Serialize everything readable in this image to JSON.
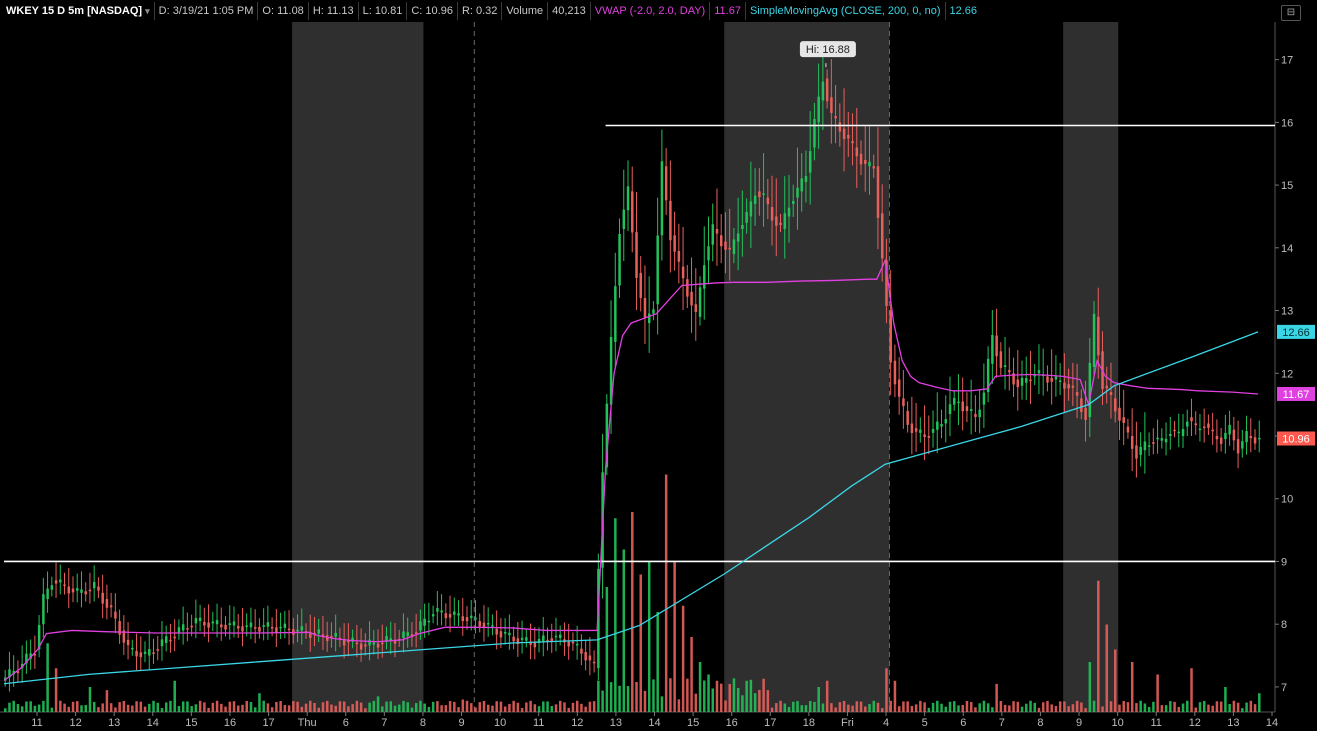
{
  "header": {
    "symbol": "WKEY 15 D 5m [NASDAQ]",
    "date": "D: 3/19/21 1:05 PM",
    "open": "O: 11.08",
    "high": "H: 11.13",
    "low": "L: 10.81",
    "close": "C: 10.96",
    "range": "R: 0.32",
    "volume_label": "Volume",
    "volume_value": "40,213",
    "vwap_label": "VWAP (-2.0, 2.0, DAY)",
    "vwap_value": "11.67",
    "sma_label": "SimpleMovingAvg (CLOSE, 200, 0, no)",
    "sma_value": "12.66"
  },
  "colors": {
    "up": "#22c25a",
    "down": "#e8605c",
    "vwap": "#e040e0",
    "sma": "#3ad6e6",
    "hline": "#ffffff",
    "extended_hours_shade": "#2f2f2f"
  },
  "chart_data": {
    "type": "candlestick",
    "title": "WKEY 15 D 5m [NASDAQ]",
    "ylim": [
      6.6,
      17.6
    ],
    "y_ticks": [
      7,
      8,
      9,
      10,
      11,
      12,
      13,
      14,
      15,
      16,
      17
    ],
    "x_tick_labels": [
      "11",
      "12",
      "13",
      "14",
      "15",
      "16",
      "17",
      "Thu",
      "6",
      "7",
      "8",
      "9",
      "10",
      "11",
      "12",
      "13",
      "14",
      "15",
      "16",
      "17",
      "18",
      "Fri",
      "4",
      "5",
      "6",
      "7",
      "8",
      "9",
      "10",
      "11",
      "12",
      "13",
      "14"
    ],
    "horizontal_lines": [
      9.0,
      15.95
    ],
    "high_annotation": "Hi: 16.88",
    "price_badges": [
      {
        "name": "sma",
        "value": "12.66"
      },
      {
        "name": "vwap",
        "value": "11.67"
      },
      {
        "name": "last",
        "value": "10.96"
      }
    ],
    "price_path": [
      [
        0,
        7.1
      ],
      [
        2,
        7.3
      ],
      [
        4,
        7.6
      ],
      [
        5,
        8.4
      ],
      [
        6,
        8.7
      ],
      [
        9,
        8.5
      ],
      [
        11,
        8.6
      ],
      [
        13,
        8.2
      ],
      [
        15,
        7.6
      ],
      [
        17,
        7.5
      ],
      [
        19,
        7.7
      ],
      [
        21,
        7.9
      ],
      [
        23,
        8.05
      ],
      [
        25,
        8.0
      ],
      [
        27,
        7.98
      ],
      [
        29,
        7.95
      ],
      [
        31,
        7.96
      ],
      [
        33,
        7.94
      ],
      [
        35,
        7.9
      ],
      [
        37,
        7.85
      ],
      [
        39,
        7.8
      ],
      [
        41,
        7.72
      ],
      [
        43,
        7.66
      ],
      [
        45,
        7.72
      ],
      [
        47,
        7.78
      ],
      [
        49,
        7.9
      ],
      [
        51,
        8.2
      ],
      [
        53,
        8.15
      ],
      [
        55,
        8.1
      ],
      [
        57,
        8.0
      ],
      [
        59,
        7.85
      ],
      [
        61,
        7.75
      ],
      [
        63,
        7.7
      ],
      [
        65,
        7.8
      ],
      [
        67,
        7.72
      ],
      [
        69,
        7.5
      ],
      [
        70,
        7.3
      ],
      [
        71,
        10.5
      ],
      [
        72,
        12.5
      ],
      [
        73,
        14.3
      ],
      [
        74,
        14.9
      ],
      [
        75,
        13.6
      ],
      [
        76,
        12.8
      ],
      [
        77,
        13.1
      ],
      [
        78,
        15.3
      ],
      [
        79,
        14.2
      ],
      [
        80,
        13.7
      ],
      [
        81,
        13.3
      ],
      [
        82,
        12.9
      ],
      [
        83,
        13.8
      ],
      [
        84,
        14.3
      ],
      [
        85,
        14.1
      ],
      [
        86,
        13.9
      ],
      [
        87,
        14.3
      ],
      [
        88,
        14.5
      ],
      [
        89,
        14.9
      ],
      [
        90,
        14.8
      ],
      [
        91,
        14.5
      ],
      [
        92,
        14.3
      ],
      [
        93,
        14.7
      ],
      [
        94,
        14.9
      ],
      [
        95,
        15.2
      ],
      [
        96,
        16.0
      ],
      [
        97,
        16.7
      ],
      [
        98,
        16.1
      ],
      [
        99,
        15.9
      ],
      [
        100,
        15.7
      ],
      [
        101,
        15.5
      ],
      [
        102,
        15.3
      ],
      [
        103,
        15.3
      ],
      [
        104,
        13.8
      ],
      [
        105,
        12.2
      ],
      [
        106,
        11.6
      ],
      [
        107,
        11.2
      ],
      [
        108,
        11.05
      ],
      [
        109,
        11.0
      ],
      [
        110,
        11.1
      ],
      [
        111,
        11.2
      ],
      [
        112,
        11.5
      ],
      [
        113,
        11.55
      ],
      [
        114,
        11.4
      ],
      [
        115,
        11.3
      ],
      [
        116,
        11.7
      ],
      [
        117,
        12.6
      ],
      [
        118,
        12.1
      ],
      [
        119,
        12.0
      ],
      [
        120,
        11.8
      ],
      [
        121,
        11.9
      ],
      [
        122,
        12.0
      ],
      [
        123,
        11.95
      ],
      [
        124,
        11.9
      ],
      [
        125,
        11.85
      ],
      [
        126,
        11.8
      ],
      [
        127,
        11.6
      ],
      [
        128,
        11.3
      ],
      [
        129,
        12.9
      ],
      [
        130,
        11.8
      ],
      [
        131,
        11.6
      ],
      [
        132,
        11.3
      ],
      [
        133,
        11.0
      ],
      [
        134,
        10.7
      ],
      [
        135,
        10.85
      ],
      [
        136,
        10.95
      ],
      [
        137,
        10.9
      ],
      [
        138,
        11.1
      ],
      [
        139,
        11.0
      ],
      [
        140,
        11.3
      ],
      [
        141,
        11.1
      ],
      [
        142,
        11.2
      ],
      [
        143,
        11.0
      ],
      [
        144,
        10.95
      ],
      [
        145,
        11.1
      ],
      [
        146,
        10.8
      ],
      [
        147,
        11.0
      ],
      [
        148,
        10.96
      ]
    ],
    "vwap_path": [
      [
        0,
        7.1
      ],
      [
        2,
        7.3
      ],
      [
        4,
        7.6
      ],
      [
        5,
        7.85
      ],
      [
        8,
        7.9
      ],
      [
        12,
        7.88
      ],
      [
        18,
        7.86
      ],
      [
        24,
        7.86
      ],
      [
        30,
        7.86
      ],
      [
        36,
        7.87
      ],
      [
        37,
        7.82
      ],
      [
        39,
        7.77
      ],
      [
        41,
        7.74
      ],
      [
        44,
        7.72
      ],
      [
        47,
        7.75
      ],
      [
        49,
        7.85
      ],
      [
        52,
        7.95
      ],
      [
        56,
        7.95
      ],
      [
        60,
        7.94
      ],
      [
        64,
        7.9
      ],
      [
        68,
        7.9
      ],
      [
        70,
        7.9
      ],
      [
        71,
        10.5
      ],
      [
        72,
        12.0
      ],
      [
        73,
        12.6
      ],
      [
        74,
        12.8
      ],
      [
        75,
        12.85
      ],
      [
        77,
        12.95
      ],
      [
        79,
        13.25
      ],
      [
        80,
        13.4
      ],
      [
        82,
        13.42
      ],
      [
        84,
        13.44
      ],
      [
        86,
        13.45
      ],
      [
        90,
        13.45
      ],
      [
        94,
        13.47
      ],
      [
        98,
        13.48
      ],
      [
        102,
        13.5
      ],
      [
        103,
        13.5
      ],
      [
        104,
        13.8
      ],
      [
        105,
        12.8
      ],
      [
        106,
        12.2
      ],
      [
        107,
        11.95
      ],
      [
        108,
        11.85
      ],
      [
        110,
        11.78
      ],
      [
        112,
        11.72
      ],
      [
        114,
        11.72
      ],
      [
        116,
        11.75
      ],
      [
        117,
        11.95
      ],
      [
        119,
        11.97
      ],
      [
        121,
        11.98
      ],
      [
        123,
        11.97
      ],
      [
        125,
        11.95
      ],
      [
        127,
        11.9
      ],
      [
        128,
        11.5
      ],
      [
        129,
        12.2
      ],
      [
        130,
        11.95
      ],
      [
        131,
        11.85
      ],
      [
        133,
        11.8
      ],
      [
        135,
        11.76
      ],
      [
        137,
        11.75
      ],
      [
        139,
        11.74
      ],
      [
        141,
        11.72
      ],
      [
        143,
        11.71
      ],
      [
        145,
        11.7
      ],
      [
        148,
        11.67
      ]
    ],
    "sma_path": [
      [
        0,
        7.05
      ],
      [
        10,
        7.2
      ],
      [
        20,
        7.3
      ],
      [
        30,
        7.4
      ],
      [
        40,
        7.5
      ],
      [
        50,
        7.6
      ],
      [
        60,
        7.7
      ],
      [
        70,
        7.75
      ],
      [
        75,
        7.98
      ],
      [
        85,
        8.8
      ],
      [
        95,
        9.7
      ],
      [
        100,
        10.2
      ],
      [
        104,
        10.55
      ],
      [
        112,
        10.85
      ],
      [
        120,
        11.15
      ],
      [
        128,
        11.5
      ],
      [
        131,
        11.8
      ],
      [
        140,
        12.25
      ],
      [
        148,
        12.66
      ]
    ],
    "volume_spikes": [
      [
        5,
        1.1
      ],
      [
        6,
        0.7
      ],
      [
        10,
        0.4
      ],
      [
        12,
        0.35
      ],
      [
        20,
        0.5
      ],
      [
        30,
        0.3
      ],
      [
        44,
        0.25
      ],
      [
        54,
        0.2
      ],
      [
        70,
        0.5
      ],
      [
        71,
        2.0
      ],
      [
        72,
        3.1
      ],
      [
        73,
        2.6
      ],
      [
        74,
        3.2
      ],
      [
        75,
        2.2
      ],
      [
        76,
        2.4
      ],
      [
        77,
        1.6
      ],
      [
        78,
        3.8
      ],
      [
        79,
        2.4
      ],
      [
        80,
        1.7
      ],
      [
        81,
        1.2
      ],
      [
        82,
        0.8
      ],
      [
        83,
        0.6
      ],
      [
        84,
        0.5
      ],
      [
        90,
        0.35
      ],
      [
        96,
        0.4
      ],
      [
        97,
        0.5
      ],
      [
        104,
        0.7
      ],
      [
        105,
        0.5
      ],
      [
        117,
        0.45
      ],
      [
        128,
        0.8
      ],
      [
        129,
        2.1
      ],
      [
        130,
        1.4
      ],
      [
        131,
        1.0
      ],
      [
        133,
        0.8
      ],
      [
        136,
        0.6
      ],
      [
        140,
        0.7
      ],
      [
        144,
        0.4
      ],
      [
        148,
        0.3
      ]
    ]
  }
}
